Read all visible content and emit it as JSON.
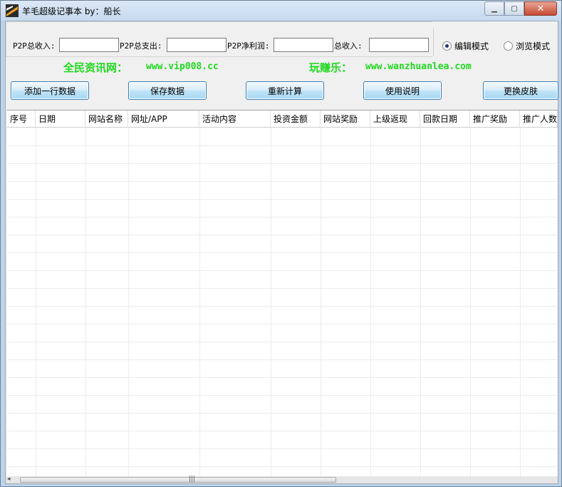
{
  "window": {
    "title": "羊毛超级记事本 by：船长"
  },
  "summary": {
    "p2p_income_label": "P2P总收入:",
    "p2p_expense_label": "P2P总支出:",
    "p2p_net_label": "P2P净利润:",
    "total_income_label": "总收入:",
    "p2p_income_value": "",
    "p2p_expense_value": "",
    "p2p_net_value": "",
    "total_income_value": ""
  },
  "mode": {
    "edit_label": "编辑模式",
    "browse_label": "浏览模式",
    "selected": "edit"
  },
  "banner": {
    "site1_name": "全民资讯网：",
    "site1_url": "www.vip008.cc",
    "site2_name": "玩赚乐：",
    "site2_url": "www.wanzhuanlea.com",
    "color": "#1fd81f"
  },
  "toolbar": {
    "add_row": "添加一行数据",
    "save": "保存数据",
    "recalc": "重新计算",
    "help": "使用说明",
    "skin": "更换皮肤"
  },
  "table": {
    "columns": [
      "序号",
      "日期",
      "网站名称",
      "网址/APP",
      "活动内容",
      "投资金额",
      "网站奖励",
      "上级返现",
      "回款日期",
      "推广奖励",
      "推广人数"
    ]
  }
}
